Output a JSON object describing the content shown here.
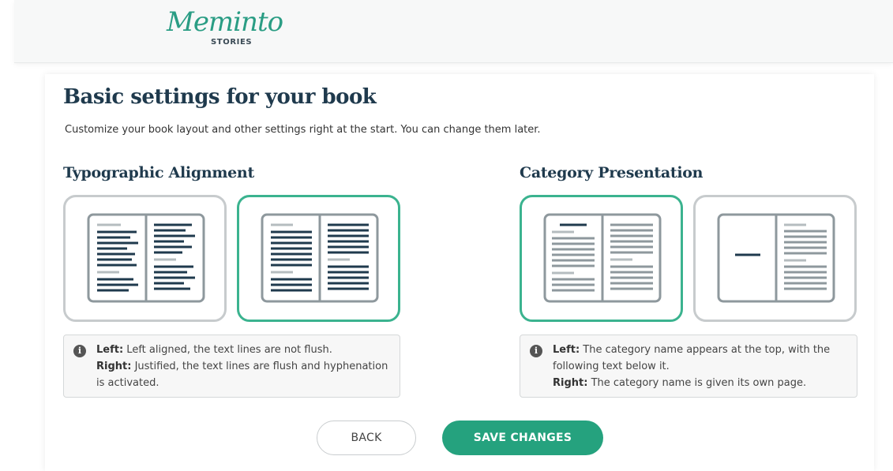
{
  "logo": {
    "script": "Meminto",
    "sub": "STORIES"
  },
  "page": {
    "title": "Basic settings for your book",
    "subtitle": "Customize your book layout and other settings right at the start. You can change them later."
  },
  "typographic": {
    "title": "Typographic Alignment",
    "selected": "right",
    "info": {
      "left_label": "Left:",
      "left_text": " Left aligned, the text lines are not flush.",
      "right_label": "Right:",
      "right_text": " Justified, the text lines are flush and hyphenation is activated."
    }
  },
  "category": {
    "title": "Category Presentation",
    "selected": "left",
    "info": {
      "left_label": "Left:",
      "left_text": " The category name appears at the top, with the following text below it.",
      "right_label": "Right:",
      "right_text": " The category name is given its own page."
    }
  },
  "buttons": {
    "back": "BACK",
    "save": "SAVE CHANGES"
  },
  "colors": {
    "accent": "#25a27e",
    "selected_border": "#3bb38f",
    "heading": "#1f3a4d"
  }
}
